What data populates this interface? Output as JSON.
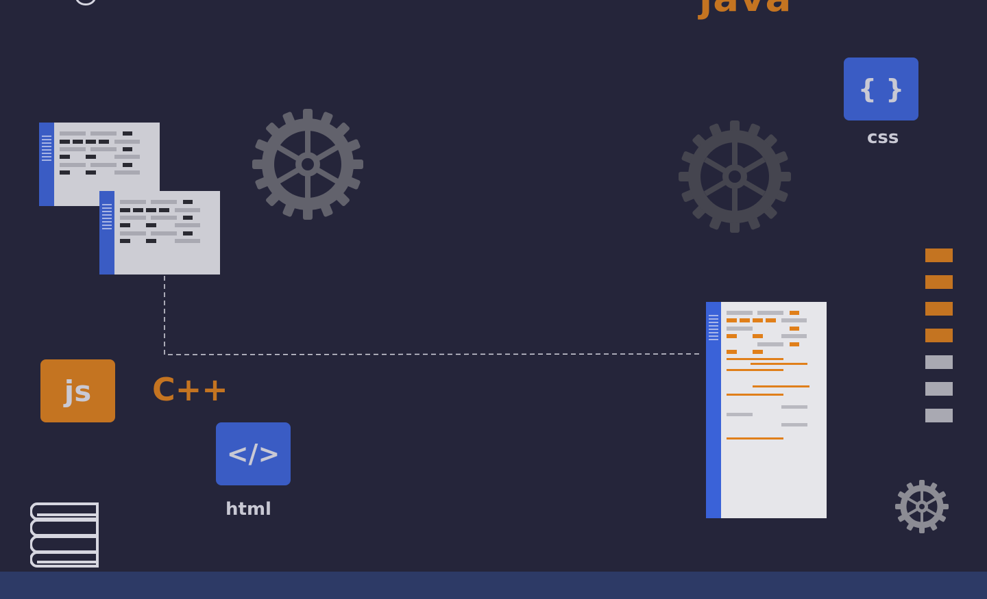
{
  "labels": {
    "java": "java",
    "css_symbol": "{ }",
    "css_label": "css",
    "html_symbol": "</>",
    "html_label": "html",
    "js_label": "js",
    "cpp_label": "C++"
  },
  "colors": {
    "background": "#25253a",
    "accent_orange": "#c47421",
    "accent_blue": "#3a5cc4",
    "gear_gray": "#62626c",
    "bottom_bar": "#2d3a66"
  },
  "icons": [
    "gear-icon",
    "code-window-icon",
    "books-stack-icon",
    "css-badge-icon",
    "html-badge-icon",
    "js-badge-icon"
  ],
  "level_stripes": {
    "filled": 4,
    "total": 7
  }
}
